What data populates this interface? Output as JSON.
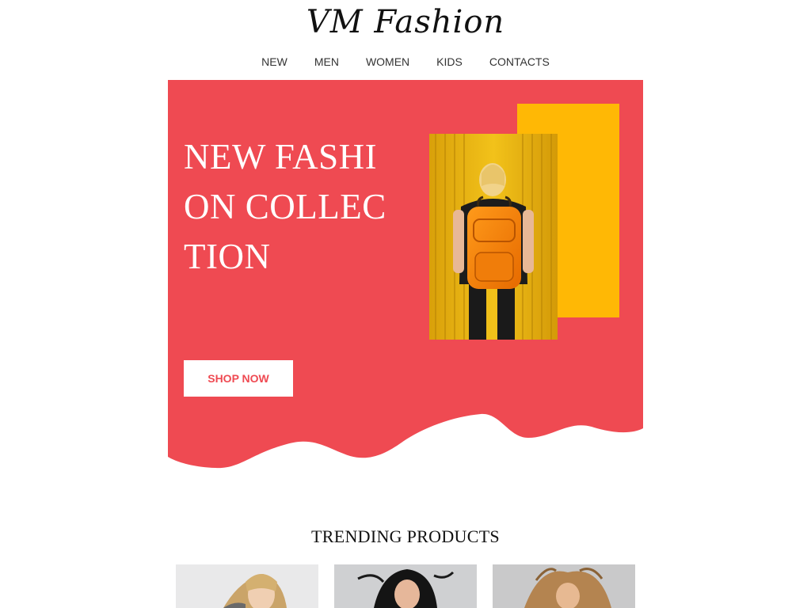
{
  "header": {
    "logo_text": "VM Fashion",
    "nav": [
      {
        "label": "NEW"
      },
      {
        "label": "MEN"
      },
      {
        "label": "WOMEN"
      },
      {
        "label": "KIDS"
      },
      {
        "label": "CONTACTS"
      }
    ]
  },
  "hero": {
    "title": "NEW FASHION COLLECTION",
    "button_label": "SHOP NOW",
    "colors": {
      "background": "#ef4a52",
      "accent_block": "#ffb805",
      "button_text": "#ef4a52"
    },
    "photo_icon": "woman-with-orange-backpack-photo"
  },
  "trending": {
    "title": "TRENDING PRODUCTS",
    "products": [
      {
        "image_icon": "blonde-woman-photo"
      },
      {
        "image_icon": "dark-haired-woman-photo"
      },
      {
        "image_icon": "woman-with-flowing-hair-photo"
      }
    ]
  }
}
